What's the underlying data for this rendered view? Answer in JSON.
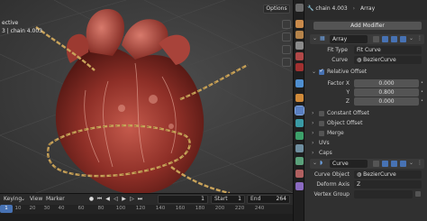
{
  "viewport": {
    "mode_label": "ective",
    "info_line": "3 | chain 4.003",
    "options_label": "Options"
  },
  "timeline": {
    "menu": [
      "Keying",
      "View",
      "Marker"
    ],
    "current_frame": "1",
    "start_label": "Start",
    "start_value": "1",
    "end_label": "End",
    "end_value": "264",
    "current_badge": "1",
    "ticks": [
      "10",
      "20",
      "30",
      "40",
      "60",
      "80",
      "100",
      "120",
      "140",
      "160",
      "180",
      "200",
      "220",
      "240"
    ]
  },
  "properties": {
    "object_name": "chain 4.003",
    "modifier_context": "Array",
    "add_modifier_label": "Add Modifier",
    "array": {
      "name": "Array",
      "fit_type_label": "Fit Type",
      "fit_type_value": "Fit Curve",
      "curve_label": "Curve",
      "curve_value": "BezierCurve",
      "relative_offset_label": "Relative Offset",
      "factor_x_label": "Factor X",
      "factor_x": "0.000",
      "factor_y_label": "Y",
      "factor_y": "0.800",
      "factor_z_label": "Z",
      "factor_z": "0.000",
      "constant_offset_label": "Constant Offset",
      "object_offset_label": "Object Offset",
      "merge_label": "Merge",
      "uvs_label": "UVs",
      "caps_label": "Caps"
    },
    "curve_mod": {
      "name": "Curve",
      "curve_object_label": "Curve Object",
      "curve_object_value": "BezierCurve",
      "deform_axis_label": "Deform Axis",
      "deform_axis_value": "Z",
      "vertex_group_label": "Vertex Group"
    }
  },
  "colors": {
    "accent": "#4772b3",
    "chain": "#c9a35a"
  }
}
